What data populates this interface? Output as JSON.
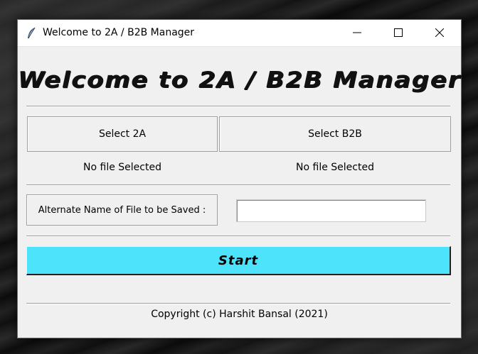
{
  "window": {
    "title": "Welcome to 2A / B2B Manager",
    "controls": {
      "minimize": "minimize-icon",
      "maximize": "maximize-icon",
      "close": "close-icon"
    },
    "app_icon": "feather-icon"
  },
  "header": {
    "heading": "Welcome to 2A / B2B Manager"
  },
  "files": {
    "select_2a_label": "Select 2A",
    "select_b2b_label": "Select B2B",
    "status_2a": "No file Selected",
    "status_b2b": "No file Selected"
  },
  "save": {
    "label": "Alternate Name of File to be Saved :",
    "value": ""
  },
  "actions": {
    "start_label": "Start",
    "start_color": "#4de4fb"
  },
  "footer": {
    "copyright": "Copyright (c) Harshit Bansal (2021)"
  }
}
